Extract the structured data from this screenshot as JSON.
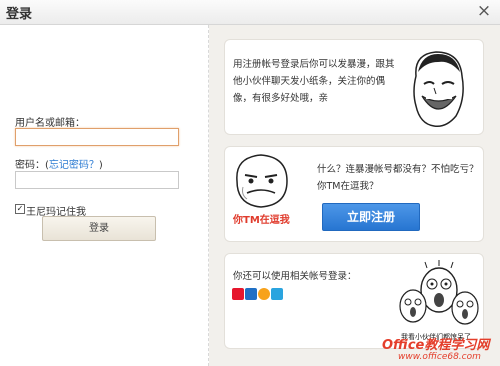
{
  "window": {
    "title": "登录",
    "close_glyph": "×"
  },
  "login": {
    "email_label": "用户名或邮箱：",
    "email_value": "",
    "password_label": "密码：(",
    "forgot_link": "忘记密码？",
    "password_label_end": ")",
    "password_value": "",
    "remember_checked": true,
    "remember_label": "王尼玛记住我",
    "submit_label": "登录"
  },
  "promo": {
    "line1": "用注册帐号登录后你可以发暴漫，跟其",
    "line2": "他小伙伴聊天发小纸条，关注你的偶",
    "line3": "像，有很多好处哦，亲"
  },
  "register": {
    "line1": "什么？连暴漫帐号都没有？不怕吃亏？",
    "line2": "你TM在逗我？",
    "meme_caption": "你TM在逗我",
    "button_label": "立即注册"
  },
  "social": {
    "text": "你还可以使用相关帐号登录：",
    "meme_caption": "我看小伙伴们都惊呆了",
    "icons": [
      {
        "name": "weibo-icon",
        "color": "#e6162d"
      },
      {
        "name": "renren-icon",
        "color": "#1f6fc5"
      },
      {
        "name": "qq-icon",
        "color": "#f7a21b"
      },
      {
        "name": "douban-icon",
        "color": "#2aa4df"
      }
    ]
  },
  "watermark": {
    "brand": "Office教程学习网",
    "url": "www.office68.com"
  }
}
